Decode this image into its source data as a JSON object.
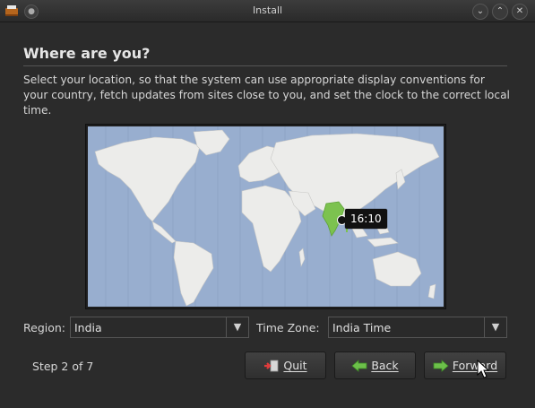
{
  "window": {
    "title": "Install"
  },
  "page": {
    "heading": "Where are you?",
    "description": "Select your location, so that the system can use appropriate display conventions for your country, fetch updates from sites close to you, and set the clock to the correct local time."
  },
  "map": {
    "selected_time": "16:10",
    "highlight_color": "#7cc24f",
    "ocean_color": "#98aecf",
    "land_color": "#ececea"
  },
  "region": {
    "label": "Region:",
    "value": "India"
  },
  "timezone": {
    "label": "Time Zone:",
    "value": "India Time"
  },
  "footer": {
    "step_text": "Step 2 of 7",
    "quit_label": "Quit",
    "back_label": "Back",
    "forward_label": "Forward"
  },
  "icons": {
    "app": "installer-icon",
    "quit": "quit-icon",
    "back": "back-arrow-icon",
    "forward": "forward-arrow-icon"
  }
}
